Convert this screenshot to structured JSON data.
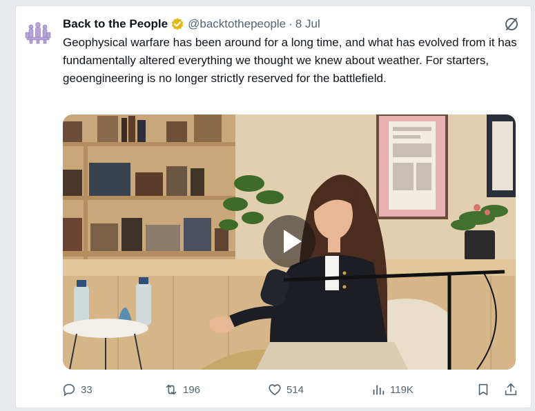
{
  "tweet": {
    "author_name": "Back to the People",
    "handle": "@backtothepeople",
    "separator": "·",
    "date": "8 Jul",
    "text": "Geophysical warfare has been around for a long time, and what has evolved from it has fundamentally altered everything we thought we knew about weather. For starters, geoengineering is no longer strictly reserved for the battlefield."
  },
  "actions": {
    "replies": "33",
    "reposts": "196",
    "likes": "514",
    "views": "119K"
  },
  "icons": {
    "avatar": "avatar-logo",
    "verified": "verified-badge-icon",
    "grok": "grok-icon",
    "play": "play-icon",
    "reply": "reply-icon",
    "repost": "repost-icon",
    "like": "heart-icon",
    "views": "views-chart-icon",
    "bookmark": "bookmark-icon",
    "share": "share-icon"
  },
  "colors": {
    "text": "#0f1419",
    "secondary": "#536471",
    "verified": "#e2b719"
  }
}
